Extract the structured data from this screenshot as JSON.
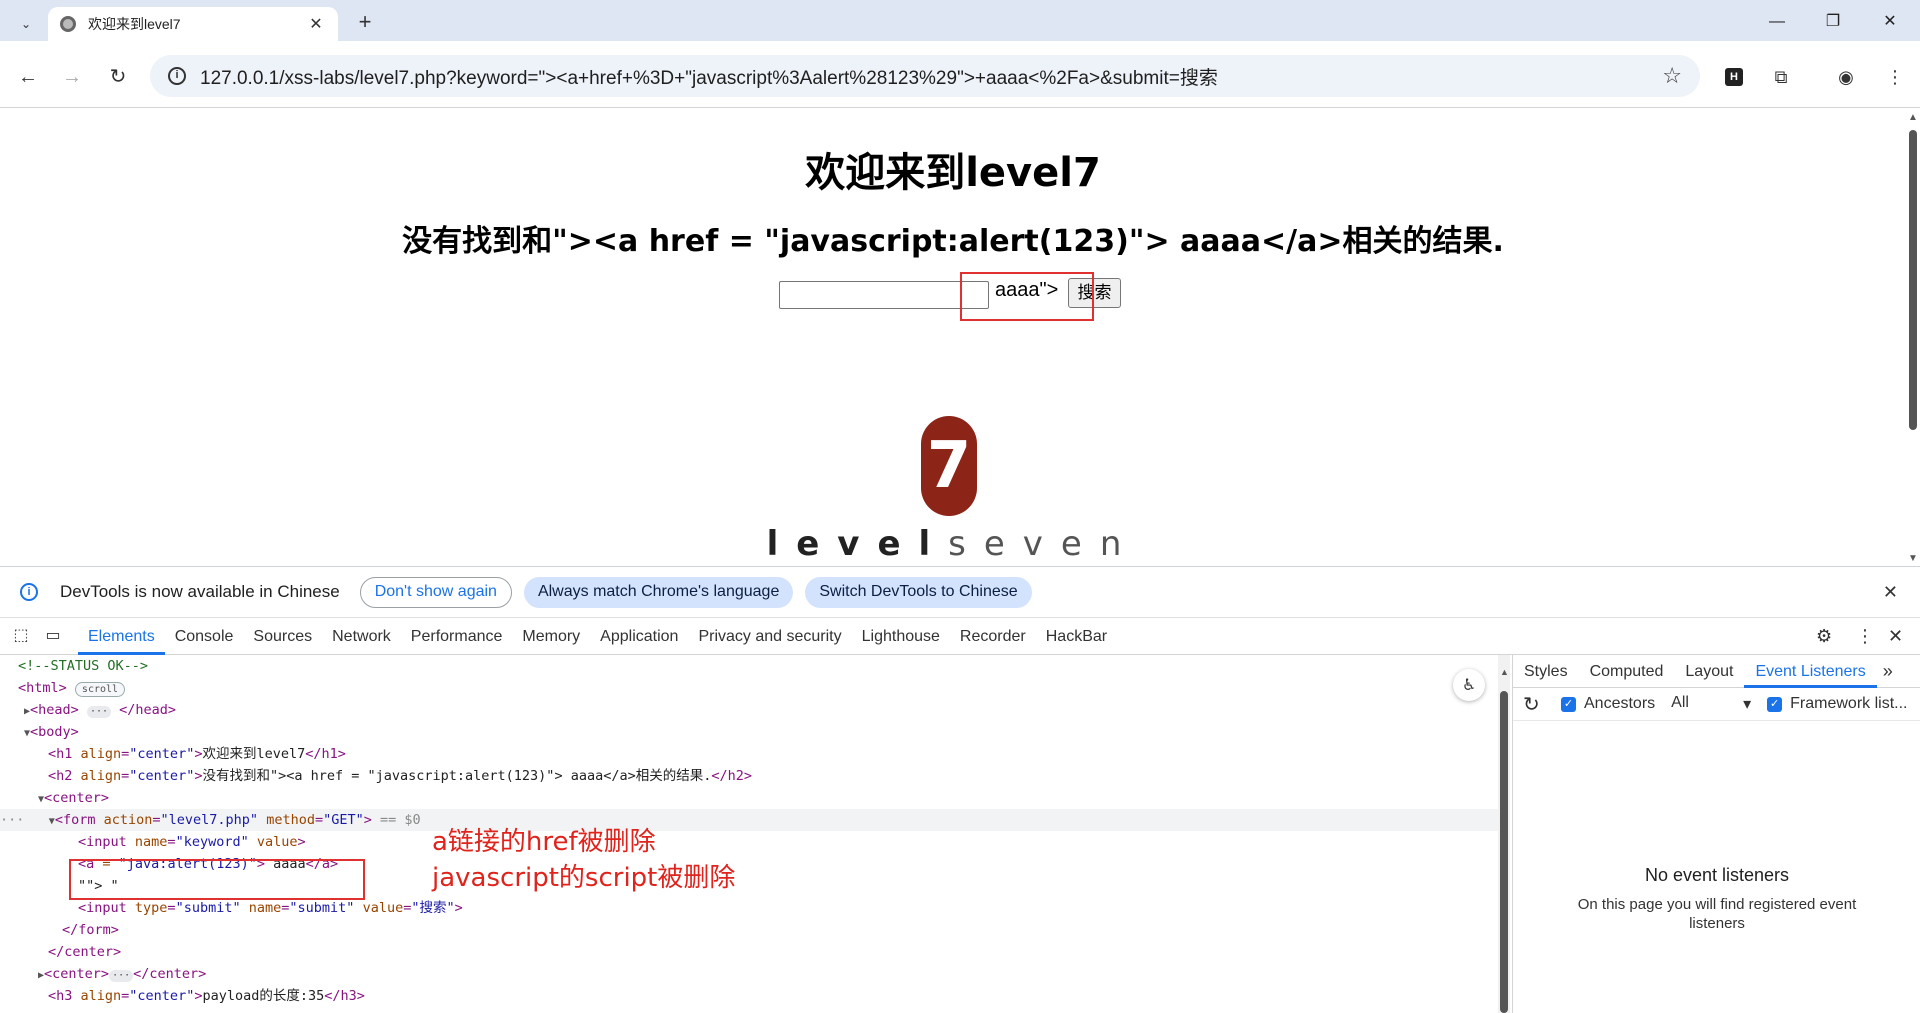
{
  "browser": {
    "tab_title": "欢迎来到level7",
    "tab_close": "✕",
    "new_tab": "+",
    "url": "127.0.0.1/xss-labs/level7.php?keyword=\"><a+href+%3D+\"javascript%3Aalert%28123%29\">+aaaa<%2Fa>&submit=搜索"
  },
  "page": {
    "h1": "欢迎来到level7",
    "h2": "没有找到和\"><a href = \"javascript:alert(123)\"> aaaa</a>相关的结果.",
    "input_value": "",
    "injected_text": "aaaa\">",
    "submit_label": "搜索",
    "logo_number": "7",
    "logo_text_bold": "level",
    "logo_text_light": "seven"
  },
  "devtools": {
    "infobar": {
      "message": "DevTools is now available in Chinese",
      "btn_dont_show": "Don't show again",
      "btn_match": "Always match Chrome's language",
      "btn_switch": "Switch DevTools to Chinese"
    },
    "tabs": [
      "Elements",
      "Console",
      "Sources",
      "Network",
      "Performance",
      "Memory",
      "Application",
      "Privacy and security",
      "Lighthouse",
      "Recorder",
      "HackBar"
    ],
    "dom": {
      "comment": "<!--STATUS OK-->",
      "scroll_badge": "scroll",
      "sel_marker": "== $0",
      "h1_text": "欢迎来到level7",
      "h2_text": "没有找到和\"><a href = \"javascript:alert(123)\"> aaaa</a>相关的结果.",
      "form_action": "\"level7.php\"",
      "form_method": "\"GET\"",
      "input_name": "\"keyword\"",
      "a_attr": "\"java:alert(123)\"",
      "a_text": " aaaa",
      "text_node": "\"\"> \"",
      "submit_type": "\"submit\"",
      "submit_name": "\"submit\"",
      "submit_value": "\"搜索\"",
      "h3_text": "payload的长度:35"
    },
    "annotations": {
      "line1": "a链接的href被删除",
      "line2": "javascript的script被删除"
    },
    "side": {
      "tabs": [
        "Styles",
        "Computed",
        "Layout",
        "Event Listeners"
      ],
      "ancestors": "Ancestors",
      "all": "All",
      "framework": "Framework list...",
      "no_listeners": "No event listeners",
      "no_listeners_sub": "On this page you will find registered event listeners"
    }
  }
}
